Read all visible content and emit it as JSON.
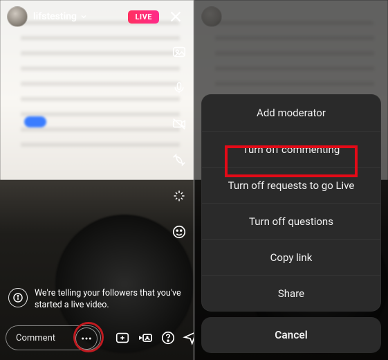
{
  "left": {
    "username": "lifstesting",
    "live_badge": "LIVE",
    "comment_placeholder": "Comment",
    "notice_text": "We're telling your followers that you've started a live video."
  },
  "sheet": {
    "items": [
      "Add moderator",
      "Turn off commenting",
      "Turn off requests to go Live",
      "Turn off questions",
      "Copy link",
      "Share"
    ],
    "cancel": "Cancel"
  }
}
